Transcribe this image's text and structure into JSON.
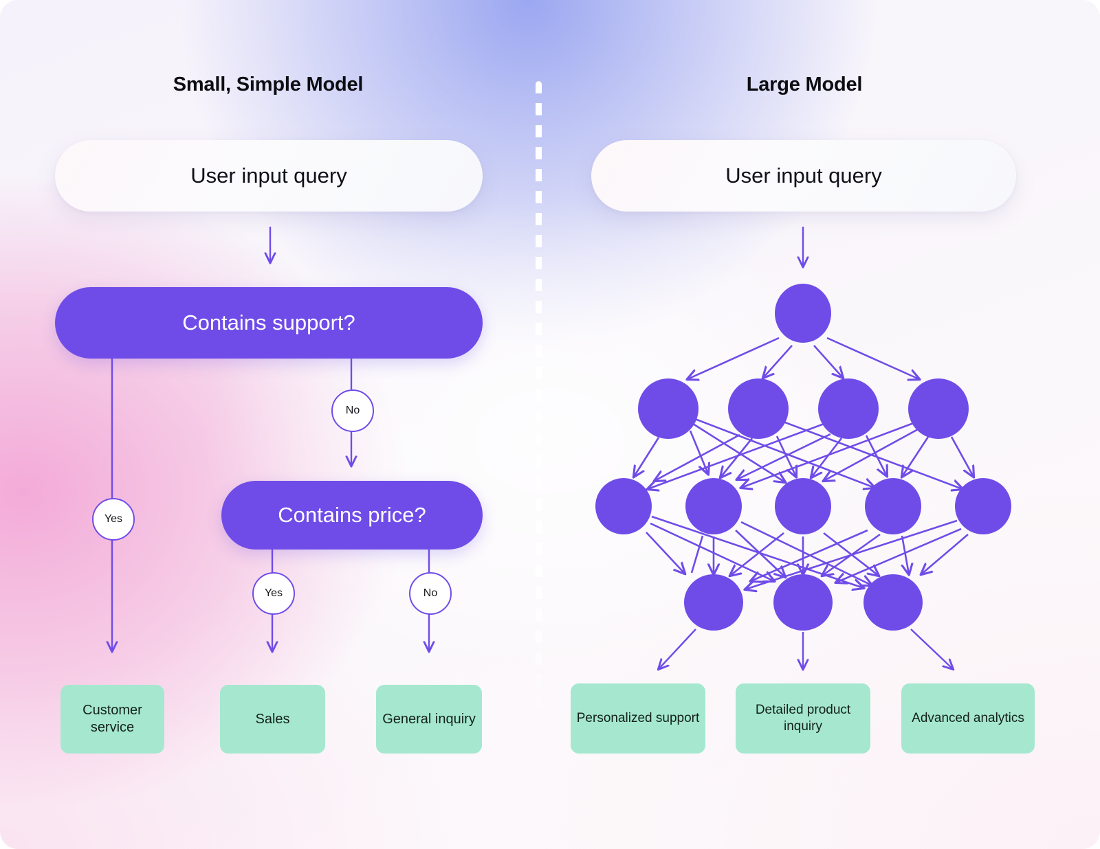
{
  "meta": {
    "colors": {
      "purple": "#6f4ce8",
      "green": "#a5e8cf",
      "text_dark": "#101018",
      "white": "#ffffff",
      "bg_pink": "#f3afd8",
      "bg_blue": "#96a3f0"
    }
  },
  "left_panel": {
    "title": "Small, Simple Model",
    "input": {
      "label": "User input query"
    },
    "decisions": [
      {
        "label": "Contains support?"
      },
      {
        "label": "Contains price?"
      }
    ],
    "branch_labels": {
      "support_yes": "Yes",
      "support_no": "No",
      "price_yes": "Yes",
      "price_no": "No"
    },
    "outcomes": [
      {
        "label": "Customer service"
      },
      {
        "label": "Sales"
      },
      {
        "label": "General inquiry"
      }
    ]
  },
  "right_panel": {
    "title": "Large Model",
    "input": {
      "label": "User input query"
    },
    "network": {
      "layers": [
        1,
        4,
        5,
        3
      ],
      "layer_names": [
        "input-node-layer",
        "hidden-layer-1",
        "hidden-layer-2",
        "output-node-layer"
      ]
    },
    "outcomes": [
      {
        "label": "Personalized support"
      },
      {
        "label": "Detailed product inquiry"
      },
      {
        "label": "Advanced analytics"
      }
    ]
  },
  "divider": {
    "style": "dashed-vertical-white"
  }
}
